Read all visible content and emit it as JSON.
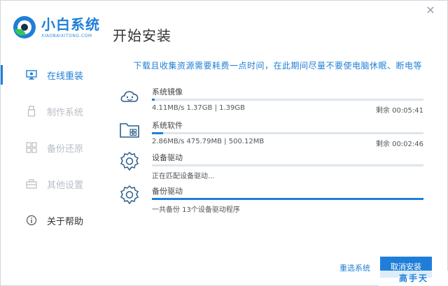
{
  "app": {
    "logo_title": "小白系统",
    "logo_sub": "XIAOBAIXITONG.COM",
    "page_title": "开始安装"
  },
  "sidebar": {
    "items": [
      {
        "label": "在线重装",
        "icon": "monitor-icon",
        "state": "active"
      },
      {
        "label": "制作系统",
        "icon": "usb-icon",
        "state": "disabled"
      },
      {
        "label": "备份还原",
        "icon": "backup-icon",
        "state": "disabled"
      },
      {
        "label": "其他设置",
        "icon": "toolbox-icon",
        "state": "disabled"
      },
      {
        "label": "关于帮助",
        "icon": "info-icon",
        "state": "normal"
      }
    ]
  },
  "notice": "下载且收集资源需要耗费一点时间，在此期间尽量不要使电脑休眠、断电等",
  "tasks": [
    {
      "name": "系统镜像",
      "icon": "cloud-face-icon",
      "progress": 0.01,
      "stats": "4.11MB/s 1.37GB | 1.39GB",
      "remaining": "剩余 00:05:41"
    },
    {
      "name": "系统软件",
      "icon": "folder-apps-icon",
      "progress": 0.04,
      "stats": "2.86MB/s 475.79MB | 500.12MB",
      "remaining": "剩余 00:02:46"
    },
    {
      "name": "设备驱动",
      "icon": "gear-icon",
      "progress": 0.0,
      "stats": "正在匹配设备驱动...",
      "remaining": ""
    },
    {
      "name": "备份驱动",
      "icon": "gear-icon",
      "progress": 1.0,
      "stats": "一共备份 13个设备驱动程序",
      "remaining": ""
    }
  ],
  "buttons": {
    "reselect": "重选系统",
    "cancel": "取消安装"
  },
  "watermark": "高手天",
  "colors": {
    "accent": "#1f7fd8",
    "disabled": "#b8bec6"
  }
}
